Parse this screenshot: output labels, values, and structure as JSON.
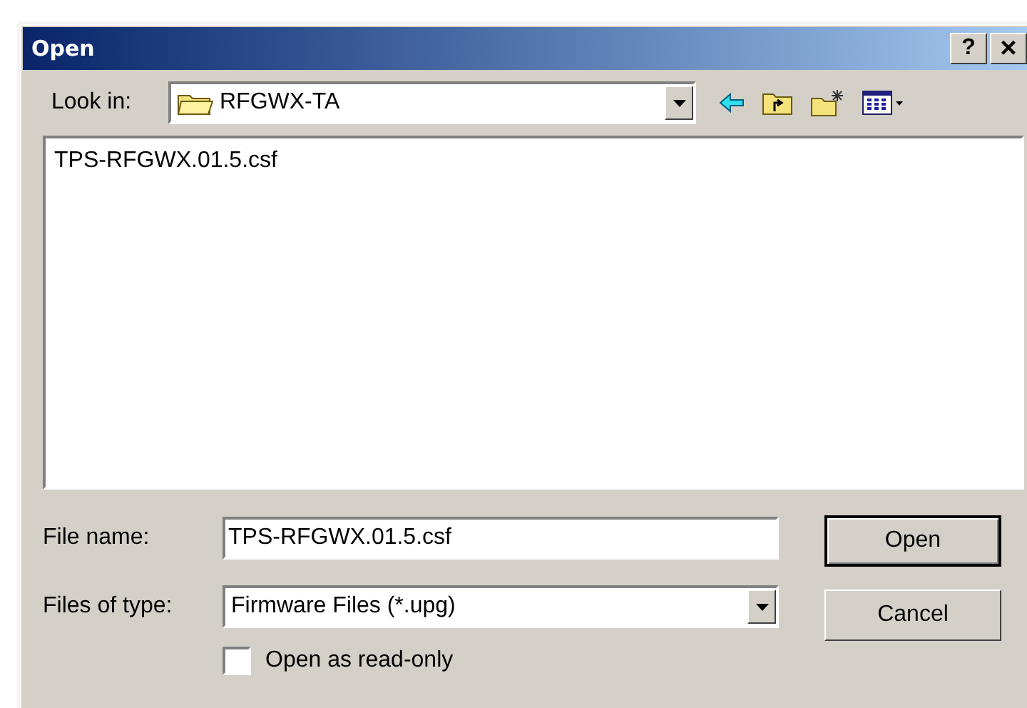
{
  "window": {
    "title": "Open",
    "help_button": "?",
    "close_button": "×"
  },
  "look_in": {
    "label": "Look in:",
    "value": "RFGWX-TA"
  },
  "files": [
    {
      "name": "TPS-RFGWX.01.5.csf",
      "selected": false
    }
  ],
  "file_name": {
    "label": "File name:",
    "value": "TPS-RFGWX.01.5.csf"
  },
  "file_type": {
    "label": "Files of type:",
    "value": "Firmware Files (*.upg)"
  },
  "read_only": {
    "label": "Open as read-only",
    "checked": false
  },
  "buttons": [
    {
      "label": "Open",
      "default": true
    },
    {
      "label": "Cancel",
      "default": false
    }
  ]
}
